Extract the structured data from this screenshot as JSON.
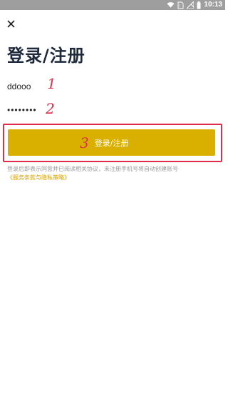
{
  "status_bar": {
    "time": "10:13",
    "icons": [
      "wifi-icon",
      "no-sim-icon",
      "cellular-icon",
      "battery-icon"
    ]
  },
  "close_icon": "close-icon",
  "title": "登录/注册",
  "fields": {
    "username_value": "ddooo",
    "password_value": "••••••••"
  },
  "annotations": [
    "1",
    "2",
    "3"
  ],
  "button": {
    "label": "登录/注册"
  },
  "notice": {
    "text": "登录后即表示同意并已阅读相关协议，未注册手机号将自动创建账号",
    "link": "《服务条款与隐私策略》"
  },
  "colors": {
    "accent": "#d9b000",
    "annotation": "#e02d4a",
    "title": "#1e2a3b"
  }
}
